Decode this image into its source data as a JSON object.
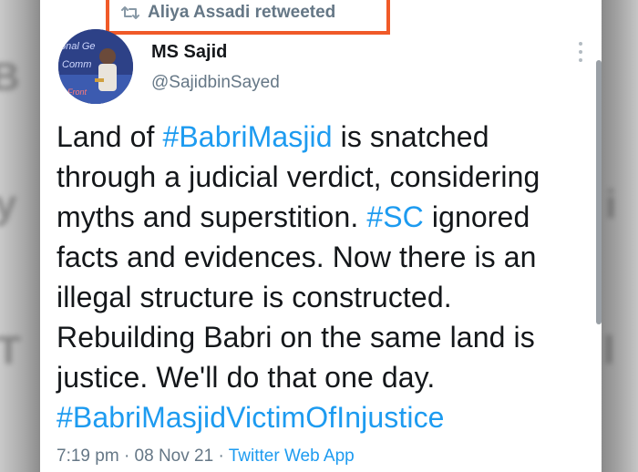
{
  "retweet": {
    "icon": "retweet-icon",
    "label": "Aliya Assadi retweeted",
    "highlight_color": "#f05a28"
  },
  "author": {
    "name": "MS Sajid",
    "handle": "@SajidbinSayed",
    "avatar_text": [
      "onal Ge",
      "Comm",
      "Front"
    ]
  },
  "tweet": {
    "lines": [
      [
        {
          "t": "Land of "
        },
        {
          "t": "#BabriMasjid",
          "tag": true
        },
        {
          "t": " is snatched"
        }
      ],
      [
        {
          "t": "through a judicial verdict, considering"
        }
      ],
      [
        {
          "t": "myths and superstition. "
        },
        {
          "t": "#SC",
          "tag": true
        },
        {
          "t": " ignored"
        }
      ],
      [
        {
          "t": "facts and evidences. Now there is an"
        }
      ],
      [
        {
          "t": "illegal structure is constructed."
        }
      ],
      [
        {
          "t": "Rebuilding Babri on the same land is"
        }
      ],
      [
        {
          "t": "justice. We'll do that one day."
        }
      ],
      [
        {
          "t": "#BabriMasjidVictimOfInjustice",
          "tag": true
        }
      ]
    ]
  },
  "meta": {
    "time": "7:19 pm",
    "date": "08 Nov 21",
    "app": "Twitter Web App",
    "separator": "·"
  },
  "colors": {
    "link": "#1d9bf0",
    "muted": "#657786",
    "text": "#14171a"
  }
}
